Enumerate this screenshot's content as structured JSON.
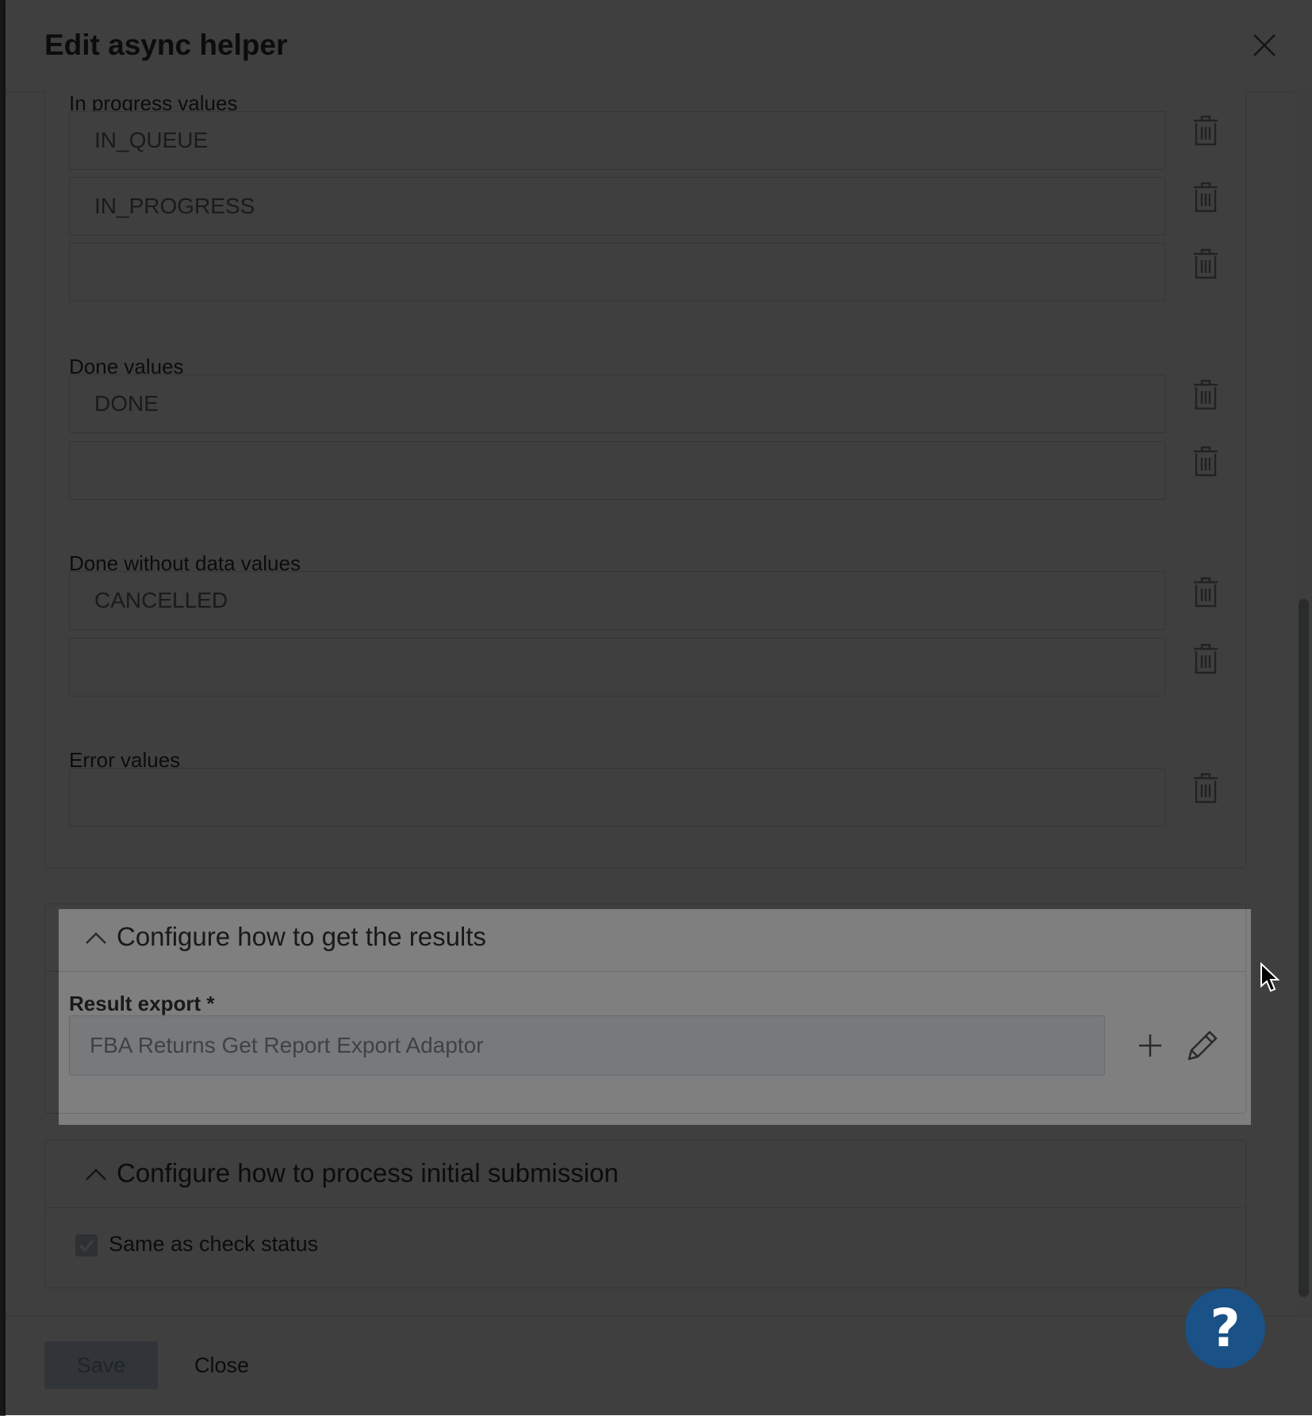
{
  "dialog": {
    "title": "Edit async helper"
  },
  "status_values": {
    "in_progress": {
      "label": "In progress values",
      "values": [
        "IN_QUEUE",
        "IN_PROGRESS",
        ""
      ]
    },
    "done": {
      "label": "Done values",
      "values": [
        "DONE",
        ""
      ]
    },
    "done_without_data": {
      "label": "Done without data values",
      "values": [
        "CANCELLED",
        ""
      ]
    },
    "error": {
      "label": "Error values",
      "values": [
        ""
      ]
    }
  },
  "results_section": {
    "title": "Configure how to get the results",
    "result_export_label": "Result export *",
    "result_export_value": "FBA Returns Get Report Export Adaptor"
  },
  "submission_section": {
    "title": "Configure how to process initial submission",
    "same_as_check_label": "Same as check status",
    "same_as_check_checked": true
  },
  "footer": {
    "save_label": "Save",
    "close_label": "Close"
  },
  "help": {
    "label": "?"
  },
  "colors": {
    "accent": "#1a5186",
    "disabled_button": "#c5d3e2",
    "overlay": "rgba(0,0,0,0.5)"
  },
  "icons": {
    "close": "close-icon",
    "delete": "trash-icon",
    "collapse": "chevron-up-icon",
    "add": "plus-icon",
    "edit": "pencil-icon",
    "help": "help-icon"
  }
}
